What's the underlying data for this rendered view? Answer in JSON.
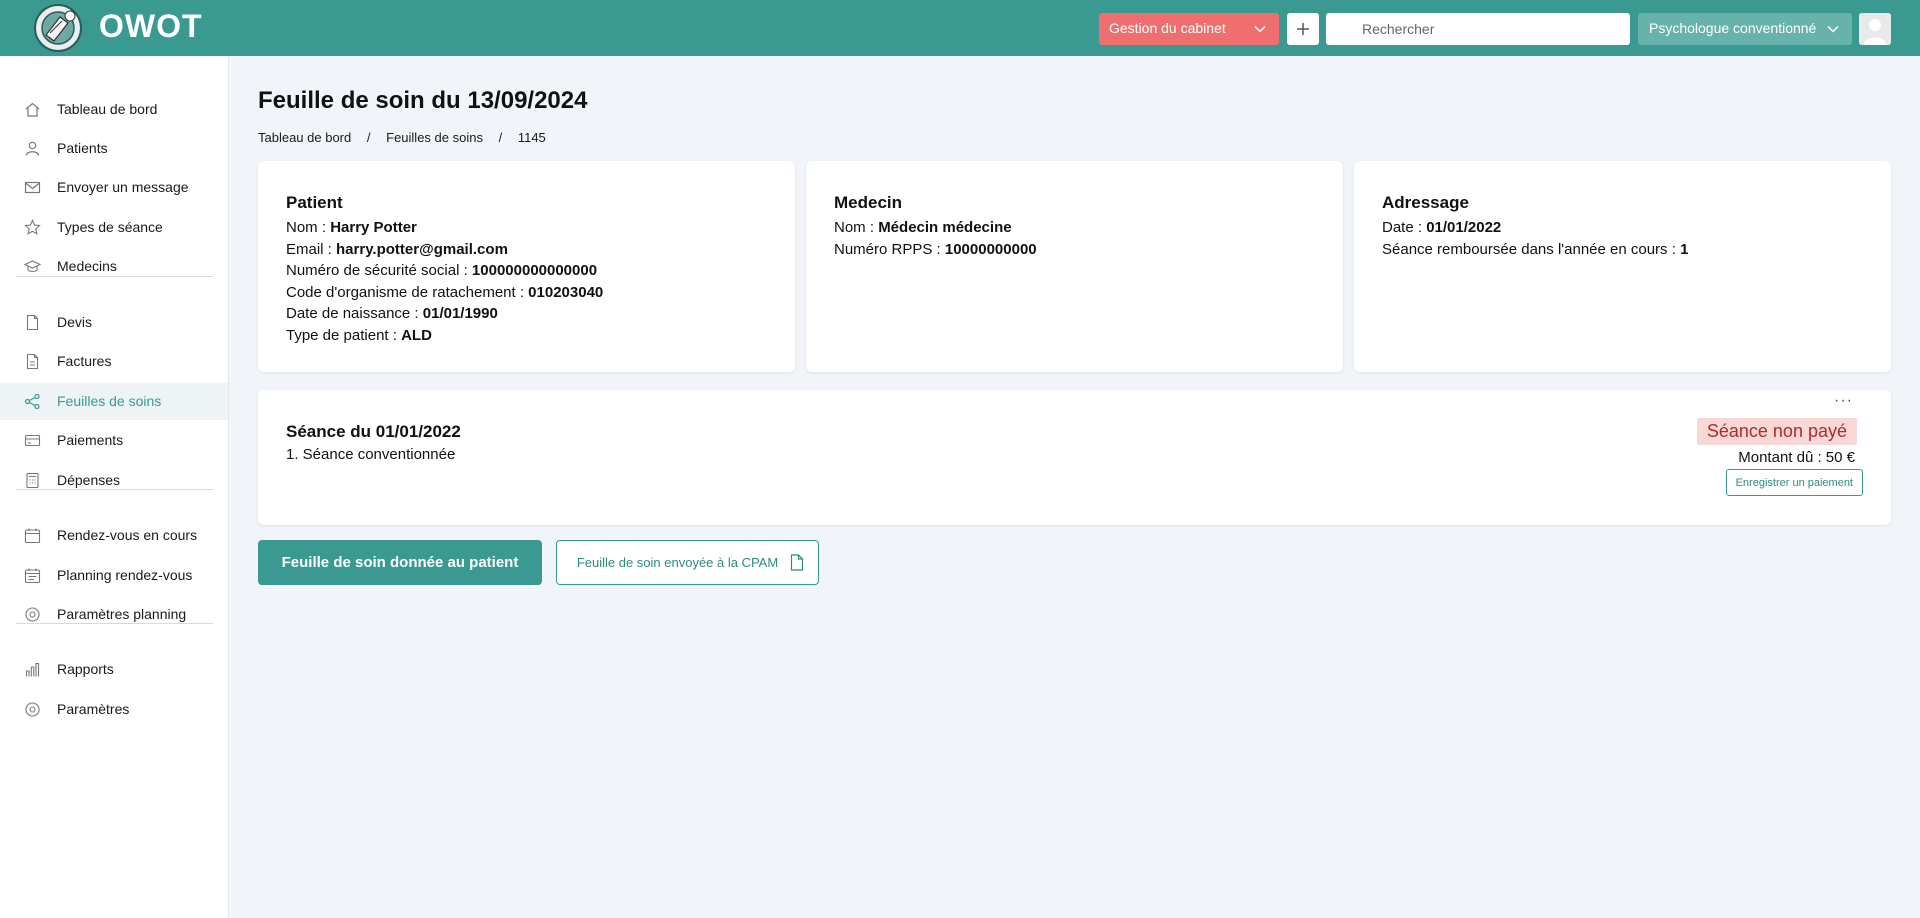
{
  "header": {
    "brand": "OWOT",
    "cabinet_label": "Gestion du cabinet",
    "search_placeholder": "Rechercher",
    "role_label": "Psychologue conventionné",
    "colors": {
      "bar": "#3a9a92",
      "cabinet": "#ef6f6f",
      "role": "#67b3ac"
    }
  },
  "sidebar": {
    "items": [
      {
        "label": "Tableau de bord",
        "icon": "home-icon"
      },
      {
        "label": "Patients",
        "icon": "user-icon"
      },
      {
        "label": "Envoyer un message",
        "icon": "mail-icon"
      },
      {
        "label": "Types de séance",
        "icon": "star-icon"
      },
      {
        "label": "Medecins",
        "icon": "graduation-cap-icon"
      },
      {
        "label": "Devis",
        "icon": "document-icon"
      },
      {
        "label": "Factures",
        "icon": "invoice-icon"
      },
      {
        "label": "Feuilles de soins",
        "icon": "share-icon",
        "active": true
      },
      {
        "label": "Paiements",
        "icon": "credit-card-icon"
      },
      {
        "label": "Dépenses",
        "icon": "calculator-icon"
      },
      {
        "label": "Rendez-vous en cours",
        "icon": "calendar-icon"
      },
      {
        "label": "Planning rendez-vous",
        "icon": "calendar-list-icon"
      },
      {
        "label": "Paramètres planning",
        "icon": "settings-icon"
      },
      {
        "label": "Rapports",
        "icon": "bar-chart-icon"
      },
      {
        "label": "Paramètres",
        "icon": "settings-icon"
      }
    ]
  },
  "page": {
    "title": "Feuille de soin du 13/09/2024",
    "breadcrumb": [
      "Tableau de bord",
      "Feuilles de soins",
      "1145"
    ],
    "breadcrumb_sep": "/"
  },
  "patient_card": {
    "title": "Patient",
    "rows": [
      {
        "label": "Nom : ",
        "value": "Harry Potter"
      },
      {
        "label": "Email : ",
        "value": "harry.potter@gmail.com"
      },
      {
        "label": "Numéro de sécurité social : ",
        "value": "100000000000000"
      },
      {
        "label": "Code d'organisme de ratachement : ",
        "value": "010203040"
      },
      {
        "label": "Date de naissance : ",
        "value": "01/01/1990"
      },
      {
        "label": "Type de patient : ",
        "value": "ALD"
      }
    ]
  },
  "medecin_card": {
    "title": "Medecin",
    "rows": [
      {
        "label": "Nom : ",
        "value": "Médecin médecine"
      },
      {
        "label": "Numéro RPPS : ",
        "value": "10000000000"
      }
    ]
  },
  "adressage_card": {
    "title": "Adressage",
    "rows": [
      {
        "label": "Date : ",
        "value": "01/01/2022"
      },
      {
        "label": "Séance remboursée dans l'année en cours : ",
        "value": "1"
      }
    ]
  },
  "seance": {
    "title": "Séance du 01/01/2022",
    "item": "1. Séance conventionnée",
    "menu": "···",
    "status": "Séance non payé",
    "montant": "Montant dû : 50 €",
    "pay_button": "Enregistrer un paiement"
  },
  "actions": {
    "primary": "Feuille de soin donnée au patient",
    "secondary": "Feuille de soin envoyée à la CPAM"
  }
}
